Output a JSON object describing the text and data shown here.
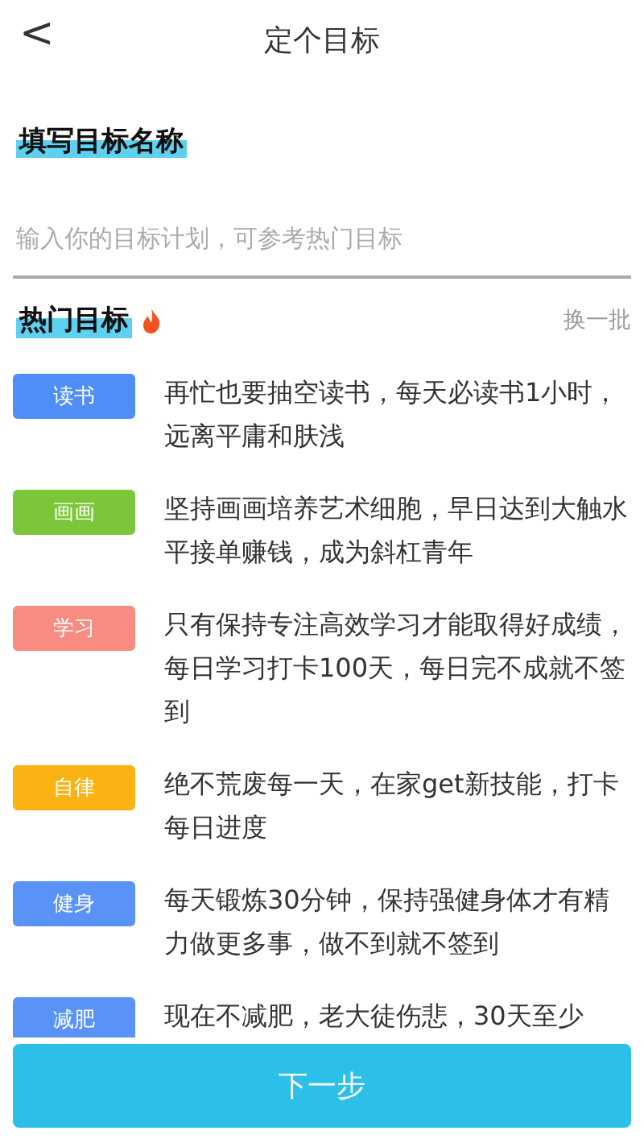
{
  "header": {
    "back": "<",
    "title": "定个目标"
  },
  "name_section": {
    "title": "填写目标名称",
    "input": {
      "placeholder": "输入你的目标计划，可参考热门目标"
    }
  },
  "hot_section": {
    "title": "热门目标",
    "refresh": "换一批"
  },
  "goals": [
    {
      "tag": "读书",
      "color": "#4f8ef7",
      "text": "再忙也要抽空读书，每天必读书1小时，远离平庸和肤浅"
    },
    {
      "tag": "画画",
      "color": "#7cc63a",
      "text": "坚持画画培养艺术细胞，早日达到大触水平接单赚钱，成为斜杠青年"
    },
    {
      "tag": "学习",
      "color": "#f98c82",
      "text": "只有保持专注高效学习才能取得好成绩，每日学习打卡100天，每日完不成就不签到"
    },
    {
      "tag": "自律",
      "color": "#fbb313",
      "text": "绝不荒废每一天，在家get新技能，打卡每日进度"
    },
    {
      "tag": "健身",
      "color": "#5a93f7",
      "text": "每天锻炼30分钟，保持强健身体才有精力做更多事，做不到就不签到"
    },
    {
      "tag": "减肥",
      "color": "#5a93f7",
      "text": "现在不减肥，老大徒伤悲，30天至少"
    }
  ],
  "next_button": "下一步"
}
